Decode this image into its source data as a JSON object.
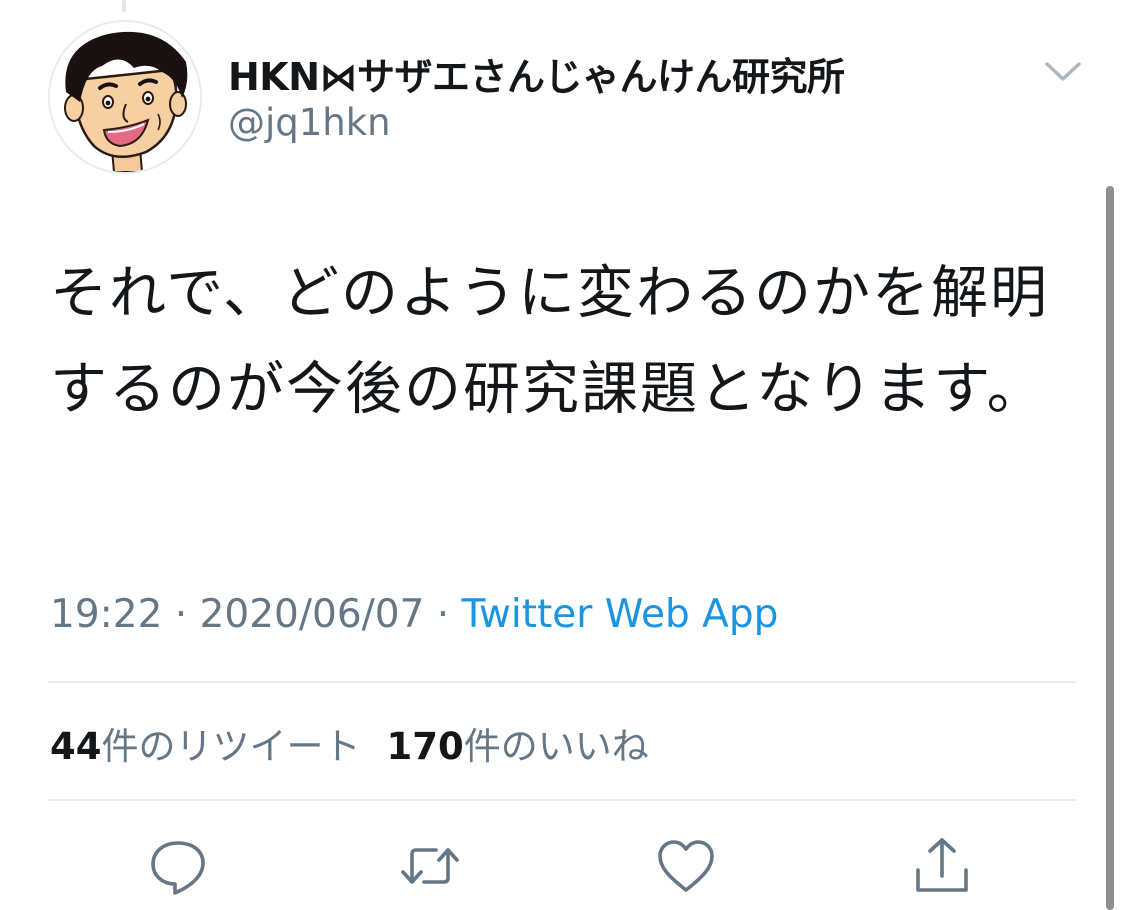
{
  "author": {
    "display_name": "HKN⋈サザエさんじゃんけん研究所",
    "handle": "@jq1hkn"
  },
  "tweet": {
    "text": "それで、どのように変わるのかを解明するのが今後の研究課題となります。"
  },
  "meta": {
    "time": "19:22",
    "separator": " · ",
    "date": "2020/06/07",
    "source": "Twitter Web App"
  },
  "stats": {
    "retweets_count": "44",
    "retweets_label": "件のリツイート",
    "likes_count": "170",
    "likes_label": "件のいいね"
  },
  "actions": [
    {
      "icon": "reply-icon"
    },
    {
      "icon": "retweet-icon"
    },
    {
      "icon": "like-icon"
    },
    {
      "icon": "share-icon"
    }
  ],
  "colors": {
    "text": "#14171a",
    "secondary": "#657786",
    "link": "#1b95e0",
    "divider": "#e6ecf0"
  }
}
